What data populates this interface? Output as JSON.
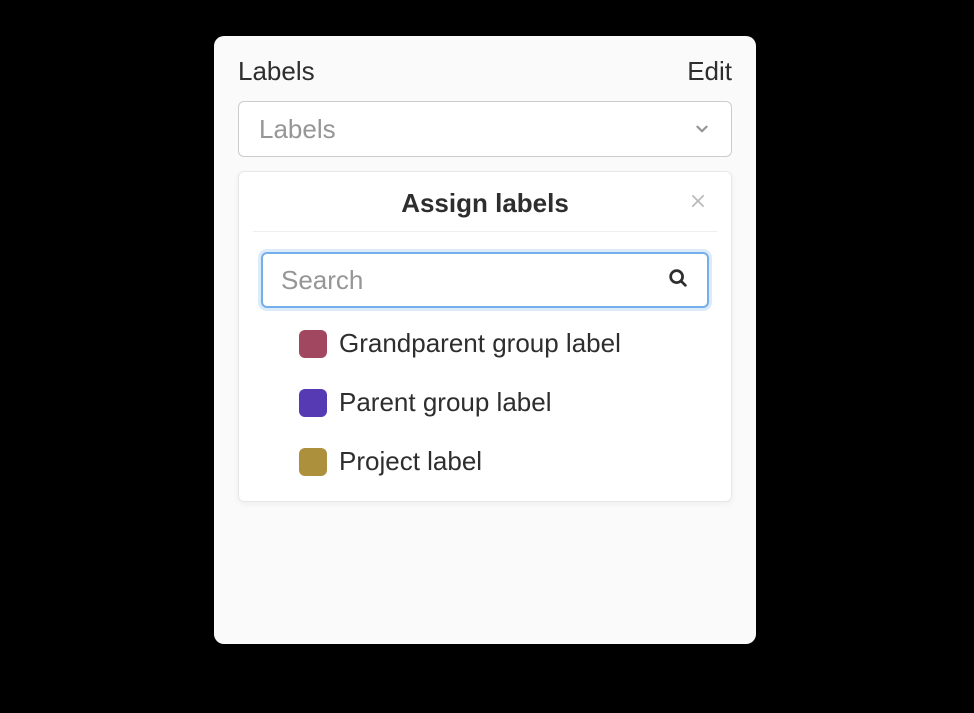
{
  "header": {
    "title": "Labels",
    "edit_label": "Edit"
  },
  "dropdown": {
    "placeholder": "Labels"
  },
  "popover": {
    "title": "Assign labels",
    "search_placeholder": "Search"
  },
  "labels": [
    {
      "text": "Grandparent group label",
      "color": "#a24760"
    },
    {
      "text": "Parent group label",
      "color": "#563ab3"
    },
    {
      "text": "Project label",
      "color": "#ad903c"
    }
  ]
}
